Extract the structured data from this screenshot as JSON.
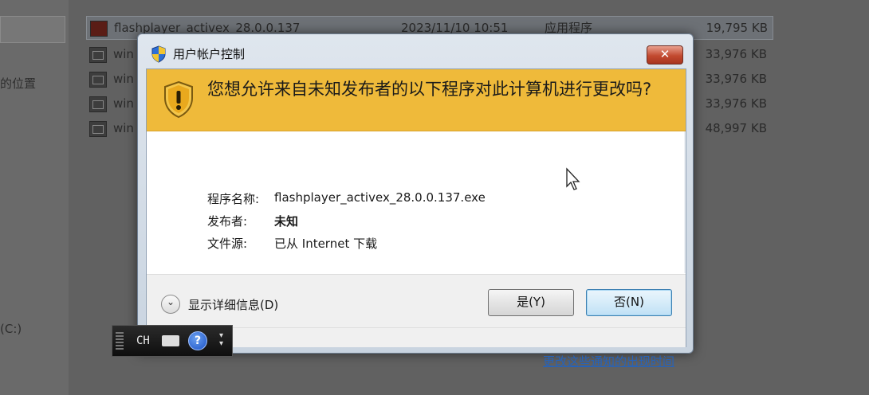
{
  "explorer": {
    "sidebar_items": [
      {
        "label": "的位置"
      },
      {
        "label": "(C:)"
      }
    ],
    "files": [
      {
        "name": "flashplayer_activex_28.0.0.137",
        "date": "2023/11/10 10:51",
        "type": "应用程序",
        "size": "19,795 KB"
      },
      {
        "name": "win",
        "size": "33,976 KB"
      },
      {
        "name": "win",
        "size": "33,976 KB"
      },
      {
        "name": "win",
        "size": "33,976 KB"
      },
      {
        "name": "win",
        "size": "48,997 KB"
      }
    ]
  },
  "dialog": {
    "title": "用户帐户控制",
    "close_label": "✕",
    "question": "您想允许来自未知发布者的以下程序对此计算机进行更改吗?",
    "info": {
      "program_label": "程序名称:",
      "program_value": "flashplayer_activex_28.0.0.137.exe",
      "publisher_label": "发布者:",
      "publisher_value": "未知",
      "source_label": "文件源:",
      "source_value": "已从 Internet 下载"
    },
    "details_label": "显示详细信息(D)",
    "yes_label": "是(Y)",
    "no_label": "否(N)",
    "link_text": "更改这些通知的出现时间"
  },
  "langbar": {
    "lang_code": "CH",
    "help": "?"
  },
  "colors": {
    "banner": "#efba3a",
    "link": "#2563bb"
  }
}
